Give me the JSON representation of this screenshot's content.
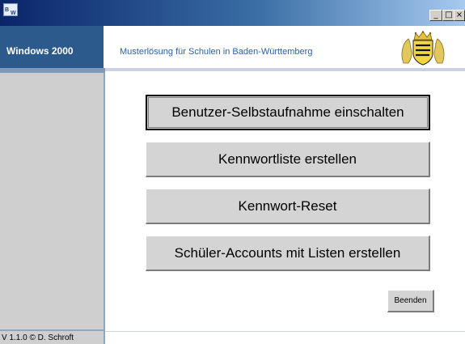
{
  "titlebar": {
    "app_icon": "bw-app-icon",
    "minimize_glyph": "_",
    "maximize_glyph": "□",
    "close_glyph": "×"
  },
  "header": {
    "os_label": "Windows 2000",
    "subtitle": "Musterlösung für Schulen in Baden-Württemberg",
    "emblem_icon": "baden-wuerttemberg-coat-of-arms"
  },
  "actions": {
    "self_registration": "Benutzer-Selbstaufnahme einschalten",
    "password_list": "Kennwortliste erstellen",
    "password_reset": "Kennwort-Reset",
    "student_accounts": "Schüler-Accounts mit Listen erstellen"
  },
  "footer": {
    "exit_label": "Beenden",
    "version": "V 1.1.0 © D. Schroft"
  },
  "colors": {
    "title_gradient_start": "#0a246a",
    "header_left_bg": "#2c5a8c",
    "subtitle_color": "#2c62a8",
    "button_face": "#d4d4d4",
    "sidebar_bg": "#cfcfcf"
  }
}
